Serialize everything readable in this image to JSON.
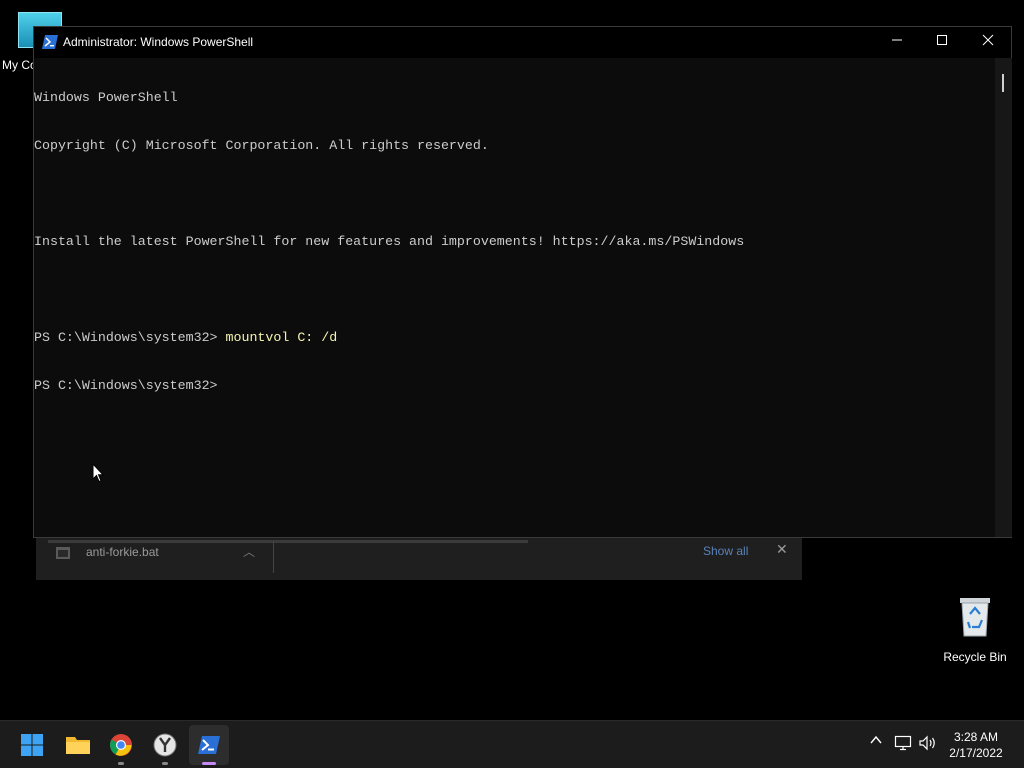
{
  "desktop": {
    "icons": [
      {
        "label": "My Co"
      },
      {
        "label": "Recycle Bin"
      }
    ]
  },
  "download_bar": {
    "file_name": "anti-forkie.bat",
    "show_all_label": "Show all"
  },
  "powershell": {
    "title": "Administrator: Windows PowerShell",
    "console_lines": [
      "Windows PowerShell",
      "Copyright (C) Microsoft Corporation. All rights reserved.",
      "",
      "Install the latest PowerShell for new features and improvements! https://aka.ms/PSWindows",
      "",
      "PS C:\\Windows\\system32> ",
      "PS C:\\Windows\\system32>"
    ],
    "typed_command": "mountvol C: /d"
  },
  "taskbar": {
    "items": [
      {
        "name": "start",
        "icon": "windows-start-icon"
      },
      {
        "name": "file-explorer",
        "icon": "folder-icon"
      },
      {
        "name": "chrome",
        "icon": "chrome-icon"
      },
      {
        "name": "app",
        "icon": "yandex-browser-icon"
      },
      {
        "name": "powershell",
        "icon": "powershell-icon",
        "active": true
      }
    ],
    "clock": {
      "time": "3:28 AM",
      "date": "2/17/2022"
    }
  },
  "colors": {
    "console_bg": "#0c0c0c",
    "console_text": "#cccccc",
    "command_text": "#f5f5b0",
    "accent": "#c58af9"
  }
}
